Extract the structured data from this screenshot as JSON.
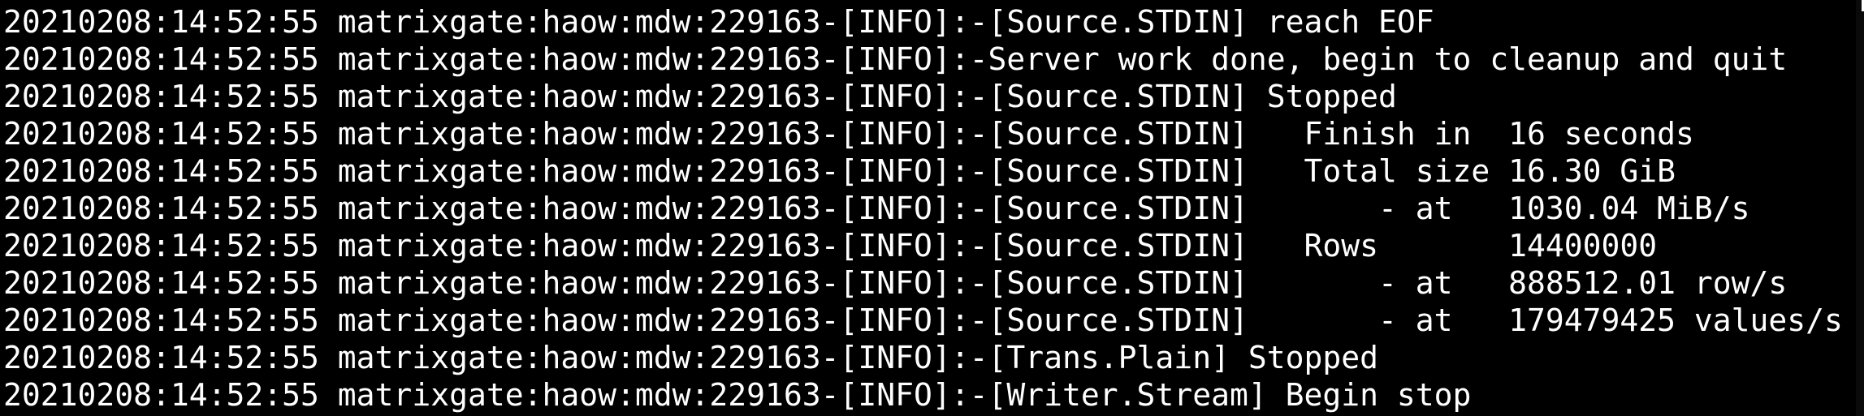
{
  "terminal": {
    "lines": [
      "20210208:14:52:55 matrixgate:haow:mdw:229163-[INFO]:-[Source.STDIN] reach EOF",
      "20210208:14:52:55 matrixgate:haow:mdw:229163-[INFO]:-Server work done, begin to cleanup and quit",
      "20210208:14:52:55 matrixgate:haow:mdw:229163-[INFO]:-[Source.STDIN] Stopped",
      "20210208:14:52:55 matrixgate:haow:mdw:229163-[INFO]:-[Source.STDIN]   Finish in  16 seconds",
      "20210208:14:52:55 matrixgate:haow:mdw:229163-[INFO]:-[Source.STDIN]   Total size 16.30 GiB",
      "20210208:14:52:55 matrixgate:haow:mdw:229163-[INFO]:-[Source.STDIN]       - at   1030.04 MiB/s",
      "20210208:14:52:55 matrixgate:haow:mdw:229163-[INFO]:-[Source.STDIN]   Rows       14400000",
      "20210208:14:52:55 matrixgate:haow:mdw:229163-[INFO]:-[Source.STDIN]       - at   888512.01 row/s",
      "20210208:14:52:55 matrixgate:haow:mdw:229163-[INFO]:-[Source.STDIN]       - at   179479425 values/s",
      "20210208:14:52:55 matrixgate:haow:mdw:229163-[INFO]:-[Trans.Plain] Stopped",
      "20210208:14:52:55 matrixgate:haow:mdw:229163-[INFO]:-[Writer.Stream] Begin stop"
    ]
  },
  "colors": {
    "background": "#000000",
    "foreground": "#ffffff"
  }
}
